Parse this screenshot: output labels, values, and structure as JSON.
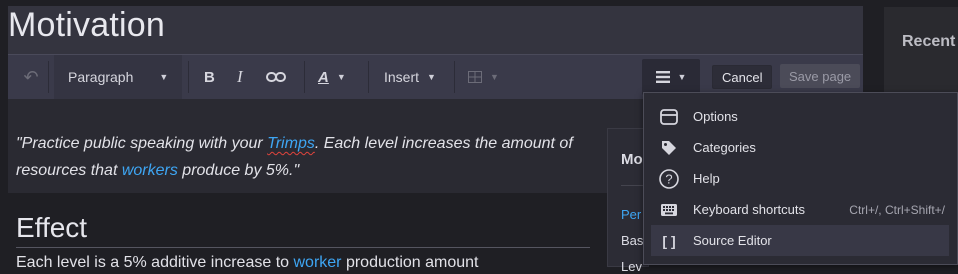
{
  "page": {
    "title": "Motivation"
  },
  "toolbar": {
    "paragraph_label": "Paragraph",
    "bold_label": "B",
    "italic_label": "I",
    "style_label": "A",
    "insert_label": "Insert",
    "cancel_label": "Cancel",
    "save_label": "Save page"
  },
  "content": {
    "quote_open": "\"Practice public speaking with your ",
    "quote_link1": "Trimps",
    "quote_mid": ". Each level increases the amount of resources that ",
    "quote_link2": "workers",
    "quote_end": " produce by 5%.\"",
    "effect_heading": "Effect",
    "effect_text_start": "Each level is a 5% additive increase to ",
    "effect_text_link": "worker",
    "effect_text_end": " production amount"
  },
  "infobox": {
    "title": "Mo",
    "row1": "Per",
    "row2": "Bas",
    "row3": "Lev"
  },
  "sidebar": {
    "heading": "Recent"
  },
  "menu": {
    "items": [
      {
        "label": "Options",
        "icon": "window-icon",
        "shortcut": ""
      },
      {
        "label": "Categories",
        "icon": "tag-icon",
        "shortcut": ""
      },
      {
        "label": "Help",
        "icon": "help-icon",
        "shortcut": ""
      },
      {
        "label": "Keyboard shortcuts",
        "icon": "keyboard-icon",
        "shortcut": "Ctrl+/, Ctrl+Shift+/"
      },
      {
        "label": "Source Editor",
        "icon": "brackets-icon",
        "shortcut": ""
      }
    ]
  },
  "colors": {
    "link": "#3ea6f4",
    "accent_bg": "#3a3a4a",
    "menu_highlight": "#383846"
  }
}
